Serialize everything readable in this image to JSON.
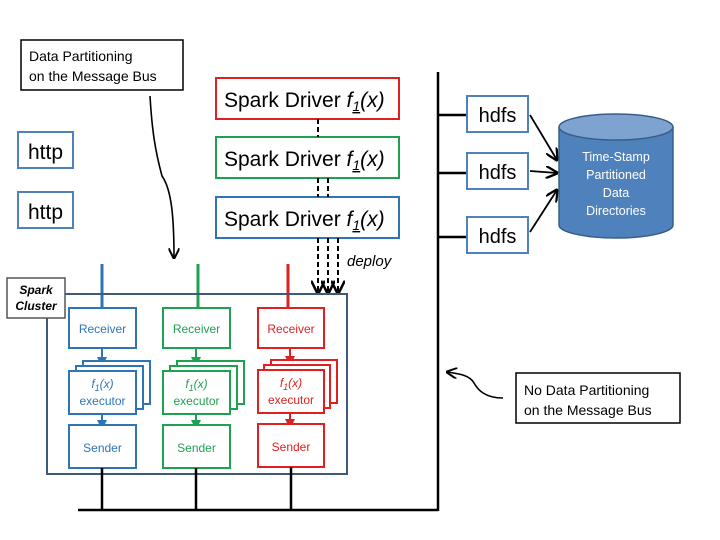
{
  "colors": {
    "blue": "#2e75b6",
    "green": "#1fa152",
    "red": "#e02020",
    "black": "#000000",
    "cluster_border": "#3f5a78",
    "http_border": "#4f81bd",
    "db_fill": "#4f81bd",
    "db_top": "#7fa3d0",
    "db_border": "#385d8a"
  },
  "callouts": {
    "top": {
      "line1": "Data Partitioning",
      "line2": "on the Message Bus"
    },
    "bottom": {
      "line1": "No Data Partitioning",
      "line2": "on the Message Bus"
    }
  },
  "http_sources": [
    {
      "label": "http"
    },
    {
      "label": "http"
    }
  ],
  "drivers": [
    {
      "label": "Spark Driver ",
      "func": "f",
      "sub": "1",
      "arg": "(x)",
      "color": "red"
    },
    {
      "label": "Spark Driver ",
      "func": "f",
      "sub": "1",
      "arg": "(x)",
      "color": "green"
    },
    {
      "label": "Spark Driver ",
      "func": "f",
      "sub": "1",
      "arg": "(x)",
      "color": "blue"
    }
  ],
  "deploy_label": "deploy",
  "cluster": {
    "label_line1": "Spark",
    "label_line2": "Cluster",
    "lanes": [
      {
        "color": "blue",
        "receiver": "Receiver",
        "exec_func": "f",
        "exec_sub": "1",
        "exec_arg": "(x)",
        "executor": "executor",
        "sender": "Sender"
      },
      {
        "color": "green",
        "receiver": "Receiver",
        "exec_func": "f",
        "exec_sub": "1",
        "exec_arg": "(x)",
        "executor": "executor",
        "sender": "Sender"
      },
      {
        "color": "red",
        "receiver": "Receiver",
        "exec_func": "f",
        "exec_sub": "1",
        "exec_arg": "(x)",
        "executor": "executor",
        "sender": "Sender"
      }
    ]
  },
  "hdfs_sinks": [
    {
      "label": "hdfs"
    },
    {
      "label": "hdfs"
    },
    {
      "label": "hdfs"
    }
  ],
  "database": {
    "line1": "Time-Stamp",
    "line2": "Partitioned",
    "line3": "Data",
    "line4": "Directories"
  }
}
